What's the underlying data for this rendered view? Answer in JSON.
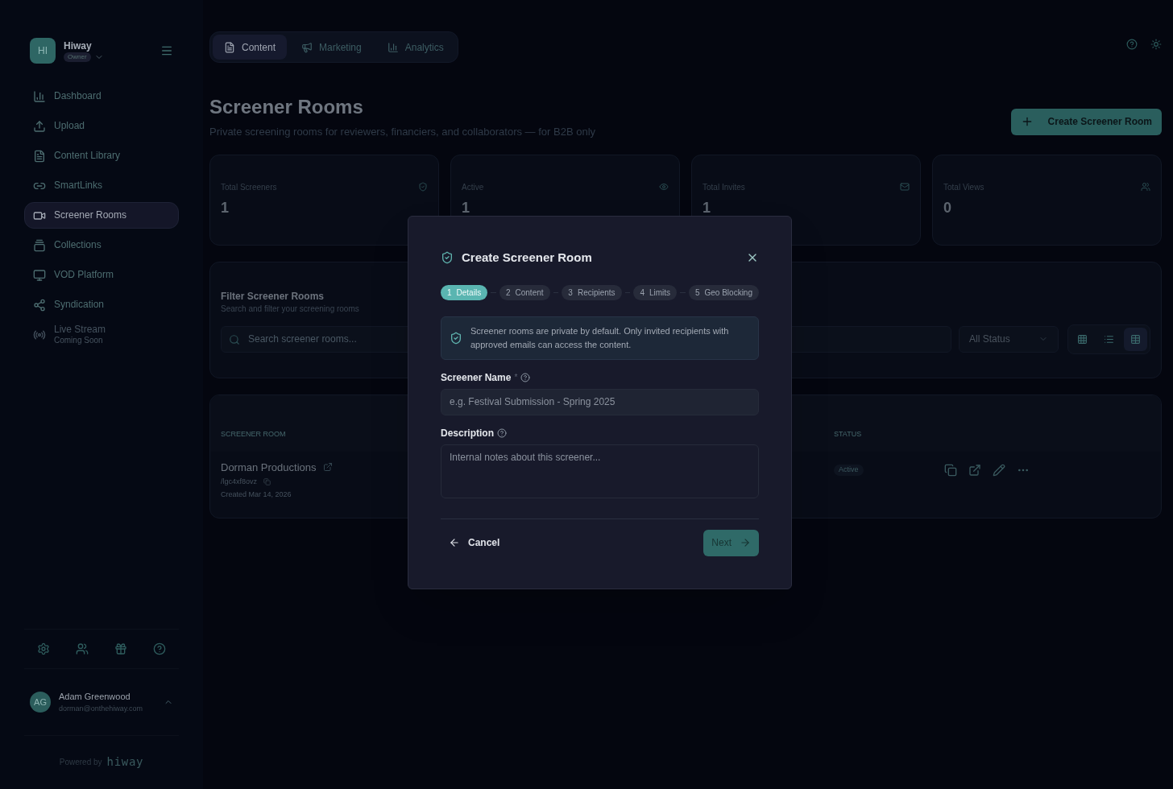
{
  "workspace": {
    "initials": "HI",
    "name": "Hiway",
    "role": "Owner"
  },
  "nav": [
    {
      "label": "Dashboard",
      "selected": false,
      "disabled": false
    },
    {
      "label": "Upload",
      "selected": false,
      "disabled": false
    },
    {
      "label": "Content Library",
      "selected": false,
      "disabled": false
    },
    {
      "label": "SmartLinks",
      "selected": false,
      "disabled": false
    },
    {
      "label": "Screener Rooms",
      "selected": true,
      "disabled": false
    },
    {
      "label": "Collections",
      "selected": false,
      "disabled": false
    },
    {
      "label": "VOD Platform",
      "selected": false,
      "disabled": false
    },
    {
      "label": "Syndication",
      "selected": false,
      "disabled": false
    },
    {
      "label": "Live Stream",
      "note": "Coming Soon",
      "selected": false,
      "disabled": true
    }
  ],
  "user": {
    "initials": "AG",
    "name": "Adam Greenwood",
    "email": "dorman@onthehiway.com"
  },
  "powered_by": {
    "text": "Powered by",
    "brand": "hiway"
  },
  "top_tabs": [
    {
      "label": "Content",
      "selected": true
    },
    {
      "label": "Marketing",
      "selected": false
    },
    {
      "label": "Analytics",
      "selected": false
    }
  ],
  "page": {
    "title": "Screener Rooms",
    "subtitle": "Private screening rooms for reviewers, financiers, and collaborators — for B2B only",
    "create_button": "Create Screener Room"
  },
  "stats": [
    {
      "label": "Total Screeners",
      "value": "1"
    },
    {
      "label": "Active",
      "value": "1"
    },
    {
      "label": "Total Invites",
      "value": "1"
    },
    {
      "label": "Total Views",
      "value": "0"
    }
  ],
  "filter": {
    "title": "Filter Screener Rooms",
    "subtitle": "Search and filter your screening rooms",
    "search_placeholder": "Search screener rooms...",
    "status": "All Status",
    "views": [
      {
        "selected": false
      },
      {
        "selected": false
      },
      {
        "selected": true
      }
    ]
  },
  "table": {
    "columns": [
      "SCREENER ROOM",
      "STATUS"
    ],
    "rows": [
      {
        "name": "Dorman Productions",
        "slug": "/lgc4xf8ovz",
        "created": "Created Mar 14, 2026",
        "status": "Active"
      }
    ]
  },
  "modal": {
    "title": "Create Screener Room",
    "steps": [
      {
        "number": "1",
        "label": "Details",
        "selected": true
      },
      {
        "number": "2",
        "label": "Content",
        "selected": false
      },
      {
        "number": "3",
        "label": "Recipients",
        "selected": false
      },
      {
        "number": "4",
        "label": "Limits",
        "selected": false
      },
      {
        "number": "5",
        "label": "Geo Blocking",
        "selected": false
      }
    ],
    "notice": "Screener rooms are private by default. Only invited recipients with approved emails can access the content.",
    "fields": [
      {
        "kind": "input",
        "label": "Screener Name",
        "required_mark": "*",
        "placeholder": "e.g. Festival Submission - Spring 2025"
      },
      {
        "kind": "textarea",
        "label": "Description",
        "placeholder": "Internal notes about this screener..."
      }
    ],
    "cancel": "Cancel",
    "next": "Next",
    "next_disabled": true
  }
}
